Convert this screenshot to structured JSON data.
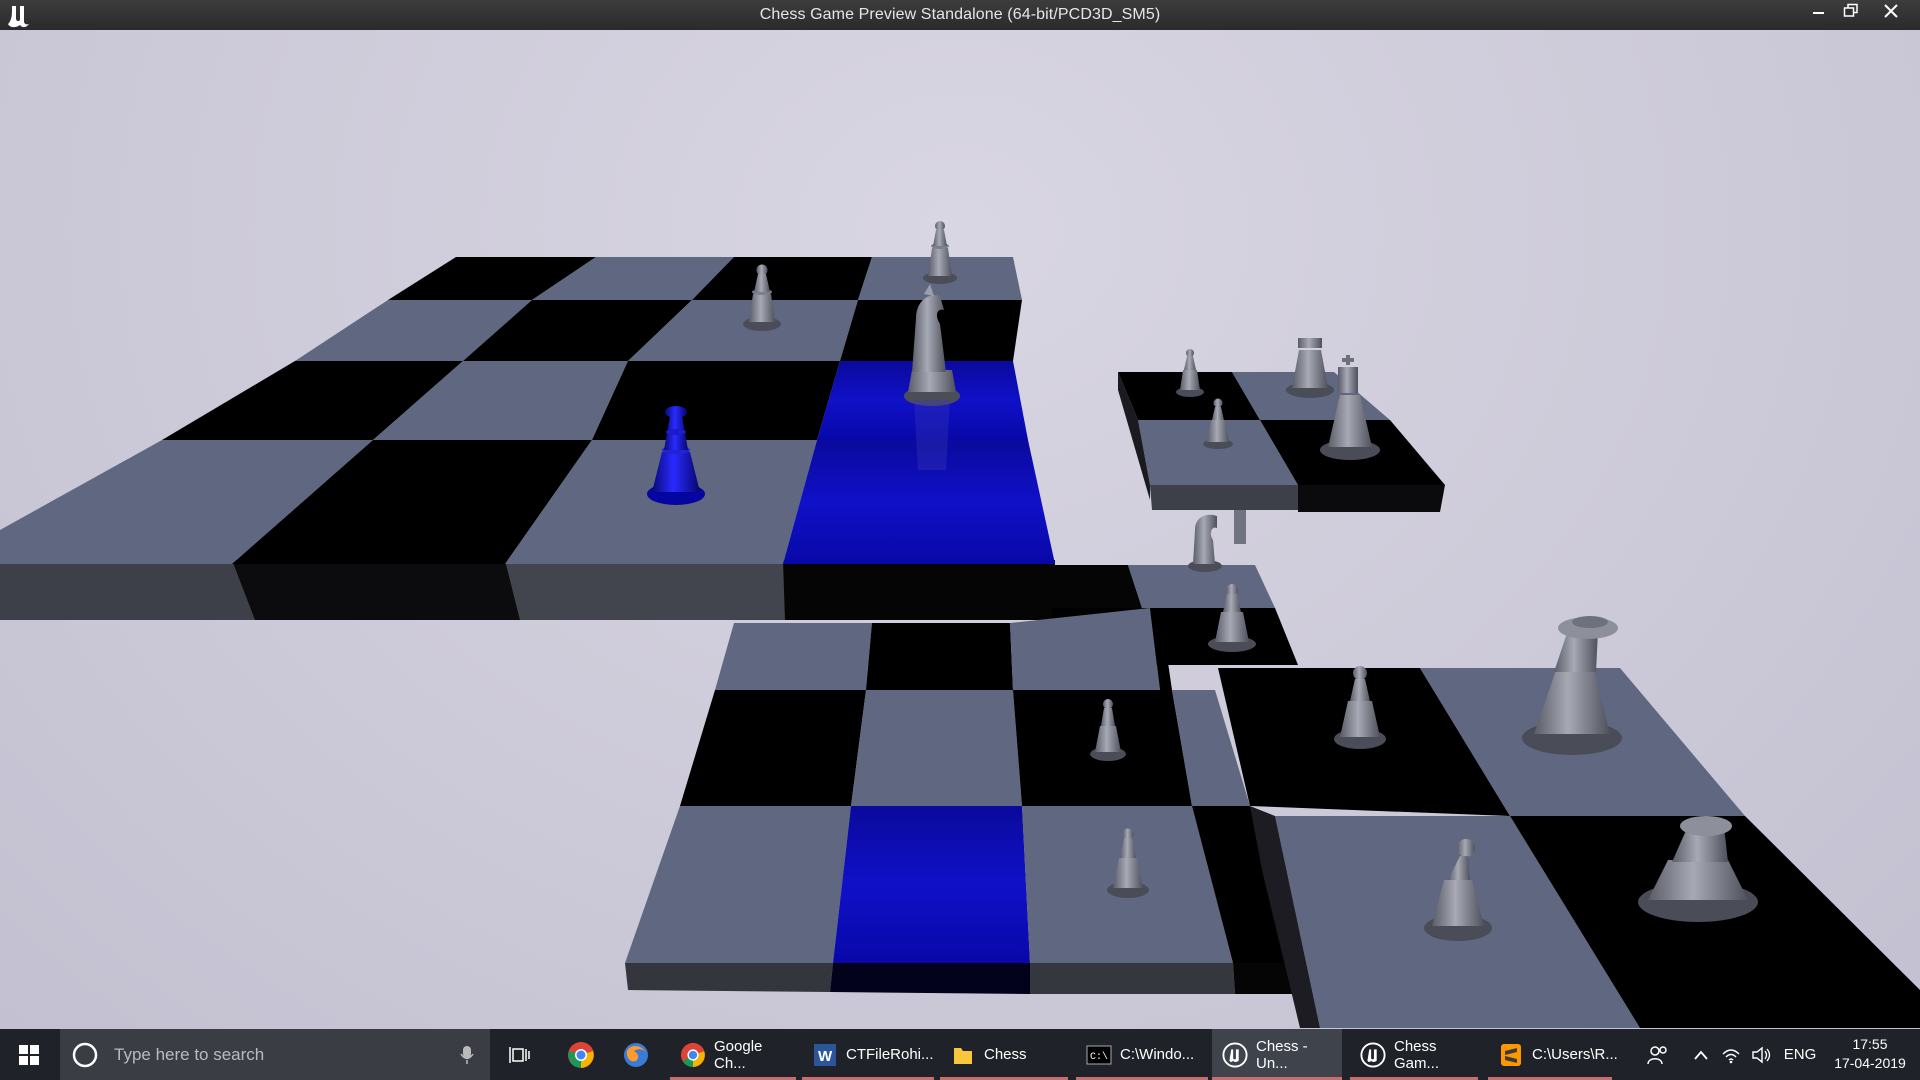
{
  "window": {
    "title": "Chess Game Preview Standalone (64-bit/PCD3D_SM5)",
    "logo_icon": "unreal-engine-icon",
    "buttons": [
      "minimize-icon",
      "restore-icon",
      "close-icon"
    ]
  },
  "scene": {
    "description_icon": "chess-3d-viewport",
    "colors": {
      "light_square": "#5f6880",
      "dark_square": "#000000",
      "highlight": "#0a0ab8",
      "player_piece": "#1313c8",
      "opponent_piece": "#8a8c98",
      "background": "#cdcad9"
    }
  },
  "taskbar": {
    "search_placeholder": "Type here to search",
    "items": [
      {
        "label": "Google Ch...",
        "icon": "chrome-icon"
      },
      {
        "label": "CTFileRohi...",
        "icon": "word-icon"
      },
      {
        "label": "Chess",
        "icon": "folder-icon"
      },
      {
        "label": "C:\\Windo...",
        "icon": "cmd-icon"
      },
      {
        "label": "Chess - Un...",
        "icon": "unreal-engine-icon"
      },
      {
        "label": "Chess Gam...",
        "icon": "unreal-engine-icon"
      },
      {
        "label": "C:\\Users\\R...",
        "icon": "sublime-icon"
      }
    ],
    "tray": {
      "language": "ENG",
      "time": "17:55",
      "date": "17-04-2019"
    }
  }
}
